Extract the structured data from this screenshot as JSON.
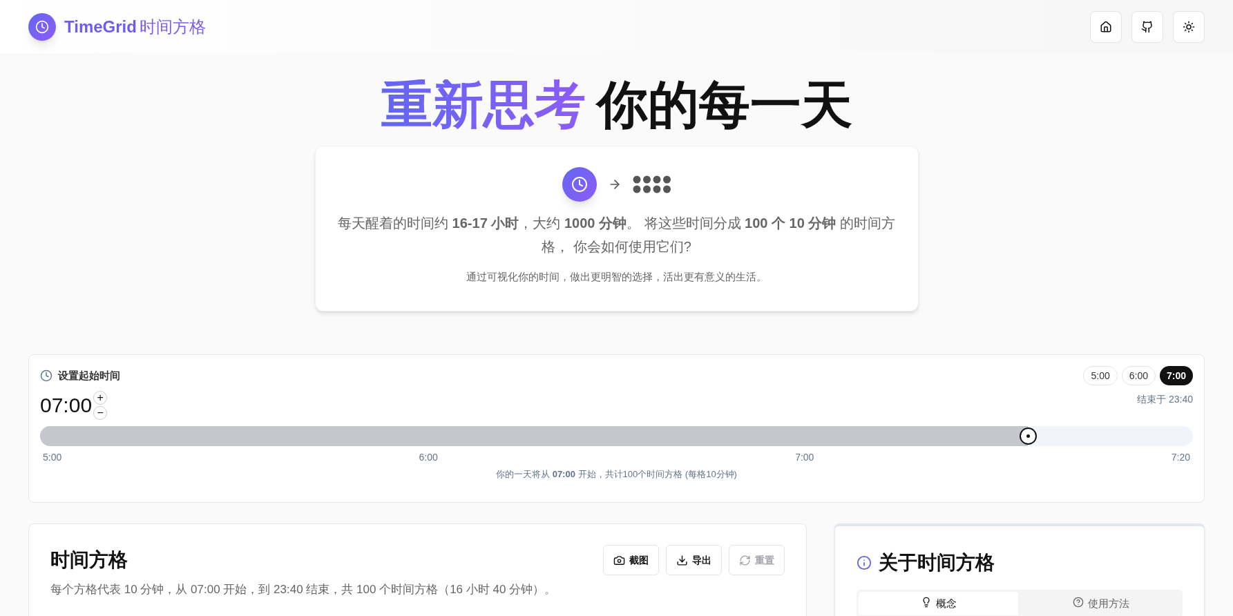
{
  "brand": {
    "name": "TimeGrid",
    "subtitle": "时间方格"
  },
  "header_buttons": [
    {
      "kind": "home"
    },
    {
      "kind": "github"
    },
    {
      "kind": "theme"
    }
  ],
  "hero": {
    "title_accent": "重新思考",
    "title_rest": "你的每一天",
    "intro": "每天醒着的时间约 **16-17 小时**，大约 **1000 分钟**。 将这些时间分成 **100 个 10 分钟** 的时间方格， 你会如何使用它们?",
    "tagline": "通过可视化你的时间，做出更明智的选择，活出更有意义的生活。"
  },
  "start_time": {
    "title": "设置起始时间",
    "presets": [
      {
        "label": "5:00",
        "selected": false
      },
      {
        "label": "6:00",
        "selected": false
      },
      {
        "label": "7:00",
        "selected": true
      }
    ],
    "value": "07:00",
    "increment": "+",
    "decrement": "−",
    "end_label": "结束于 23:40",
    "level": 0.857,
    "ticks": [
      "5:00",
      "6:00",
      "7:00",
      "7:20"
    ],
    "summary": "你的一天将从 **07:00** 开始，共计100个时间方格 (每格10分钟)"
  },
  "grid_card": {
    "title": "时间方格",
    "actions": [
      {
        "kind": "camera",
        "label": "截图",
        "disabled": false
      },
      {
        "kind": "download",
        "label": "导出",
        "disabled": false
      },
      {
        "kind": "reset",
        "label": "重置",
        "disabled": true
      }
    ],
    "description": "每个方格代表 10 分钟，从 07:00 开始，到 23:40 结束，共 100 个时间方格（16 小时 40 分钟）。"
  },
  "about_card": {
    "title": "关于时间方格",
    "tabs": [
      {
        "kind": "bulb",
        "label": "概念",
        "selected": true
      },
      {
        "kind": "help",
        "label": "使用方法",
        "selected": false
      }
    ]
  }
}
